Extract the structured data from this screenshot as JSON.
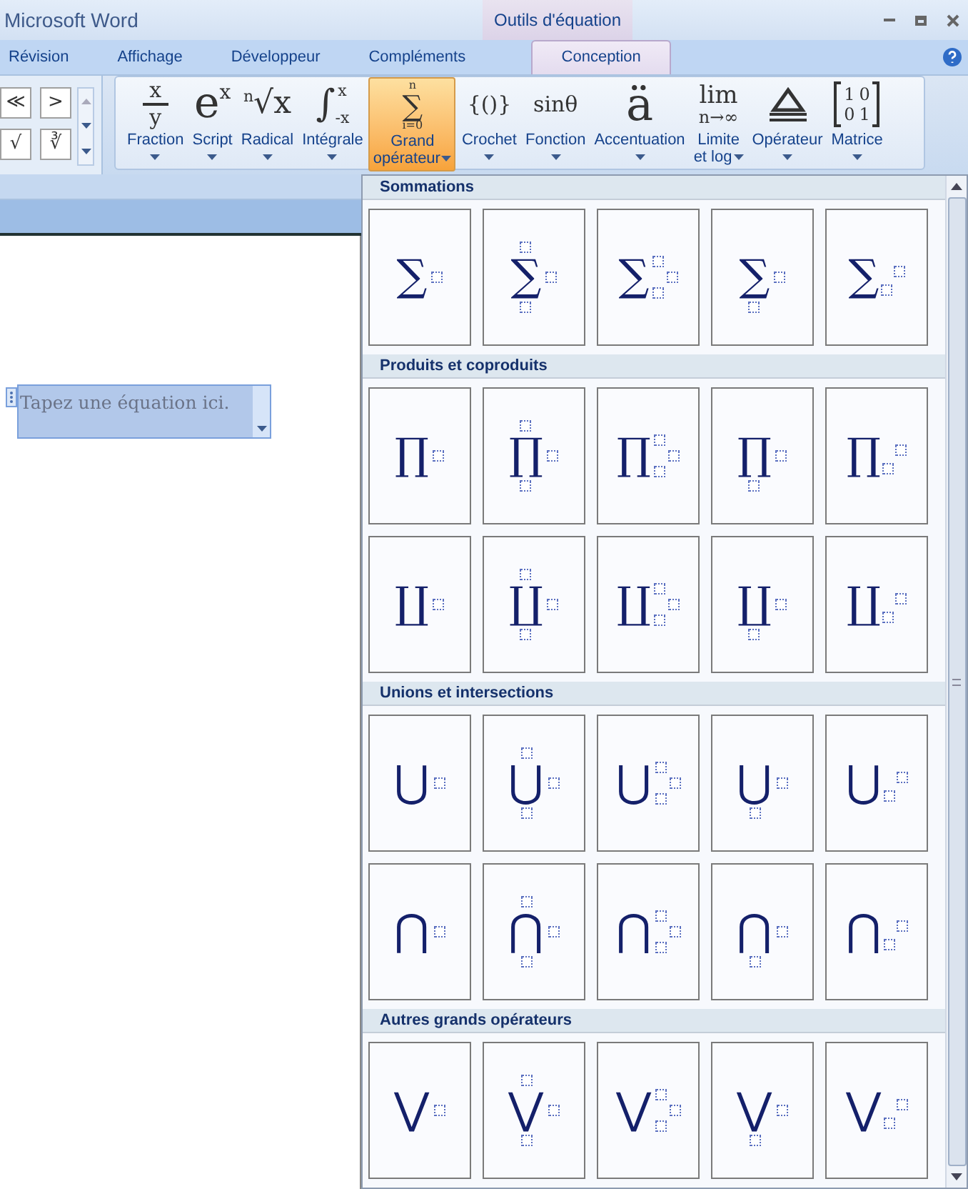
{
  "window": {
    "title": "Microsoft Word",
    "context_tab": "Outils d'équation"
  },
  "tabs": [
    {
      "label": "Révision",
      "selected": false
    },
    {
      "label": "Affichage",
      "selected": false
    },
    {
      "label": "Développeur",
      "selected": false
    },
    {
      "label": "Compléments",
      "selected": false
    },
    {
      "label": "Conception",
      "selected": true
    }
  ],
  "symbol_buttons": [
    "≪",
    ">",
    "√",
    "∛"
  ],
  "structures": [
    {
      "label": [
        "Fraction"
      ],
      "kind": "fraction",
      "parts": [
        "x",
        "y"
      ],
      "selected": false
    },
    {
      "label": [
        "Script"
      ],
      "kind": "sup",
      "parts": [
        "e",
        "x"
      ],
      "selected": false
    },
    {
      "label": [
        "Radical"
      ],
      "kind": "root",
      "parts": [
        "n",
        "√",
        "x"
      ],
      "selected": false
    },
    {
      "label": [
        "Intégrale"
      ],
      "kind": "integral",
      "parts": [
        "∫",
        "x",
        "-x"
      ],
      "selected": false
    },
    {
      "label": [
        "Grand",
        "opérateur"
      ],
      "kind": "bigop",
      "parts": [
        "n",
        "∑",
        "i=0"
      ],
      "selected": true
    },
    {
      "label": [
        "Crochet"
      ],
      "kind": "plain",
      "parts": [
        "{()}"
      ],
      "selected": false
    },
    {
      "label": [
        "Fonction"
      ],
      "kind": "plain",
      "parts": [
        "sinθ"
      ],
      "selected": false
    },
    {
      "label": [
        "Accentuation"
      ],
      "kind": "big",
      "parts": [
        "ä"
      ],
      "selected": false
    },
    {
      "label": [
        "Limite",
        "et log"
      ],
      "kind": "lim",
      "parts": [
        "lim",
        "n→∞"
      ],
      "selected": false
    },
    {
      "label": [
        "Opérateur"
      ],
      "kind": "operator",
      "selected": false
    },
    {
      "label": [
        "Matrice"
      ],
      "kind": "matrix",
      "parts": [
        "1",
        "0",
        "0",
        "1"
      ],
      "selected": false
    }
  ],
  "equation": {
    "placeholder": "Tapez une équation ici."
  },
  "gallery": [
    {
      "title": "Sommations",
      "rows": [
        [
          {
            "symbol": "∑",
            "kind": "plain"
          },
          {
            "symbol": "∑",
            "kind": "limits"
          },
          {
            "symbol": "∑",
            "kind": "scripts"
          },
          {
            "symbol": "∑",
            "kind": "lower"
          },
          {
            "symbol": "∑",
            "kind": "subscript"
          }
        ]
      ]
    },
    {
      "title": "Produits et coproduits",
      "rows": [
        [
          {
            "symbol": "∏",
            "kind": "plain"
          },
          {
            "symbol": "∏",
            "kind": "limits"
          },
          {
            "symbol": "∏",
            "kind": "scripts"
          },
          {
            "symbol": "∏",
            "kind": "lower"
          },
          {
            "symbol": "∏",
            "kind": "subscript"
          }
        ],
        [
          {
            "symbol": "∐",
            "kind": "plain"
          },
          {
            "symbol": "∐",
            "kind": "limits"
          },
          {
            "symbol": "∐",
            "kind": "scripts"
          },
          {
            "symbol": "∐",
            "kind": "lower"
          },
          {
            "symbol": "∐",
            "kind": "subscript"
          }
        ]
      ]
    },
    {
      "title": "Unions et intersections",
      "rows": [
        [
          {
            "symbol": "⋃",
            "kind": "plain"
          },
          {
            "symbol": "⋃",
            "kind": "limits"
          },
          {
            "symbol": "⋃",
            "kind": "scripts"
          },
          {
            "symbol": "⋃",
            "kind": "lower"
          },
          {
            "symbol": "⋃",
            "kind": "subscript"
          }
        ],
        [
          {
            "symbol": "⋂",
            "kind": "plain"
          },
          {
            "symbol": "⋂",
            "kind": "limits"
          },
          {
            "symbol": "⋂",
            "kind": "scripts"
          },
          {
            "symbol": "⋂",
            "kind": "lower"
          },
          {
            "symbol": "⋂",
            "kind": "subscript"
          }
        ]
      ]
    },
    {
      "title": "Autres grands opérateurs",
      "rows": [
        [
          {
            "symbol": "⋁",
            "kind": "plain"
          },
          {
            "symbol": "⋁",
            "kind": "limits"
          },
          {
            "symbol": "⋁",
            "kind": "scripts"
          },
          {
            "symbol": "⋁",
            "kind": "lower"
          },
          {
            "symbol": "⋁",
            "kind": "subscript"
          }
        ]
      ]
    }
  ]
}
